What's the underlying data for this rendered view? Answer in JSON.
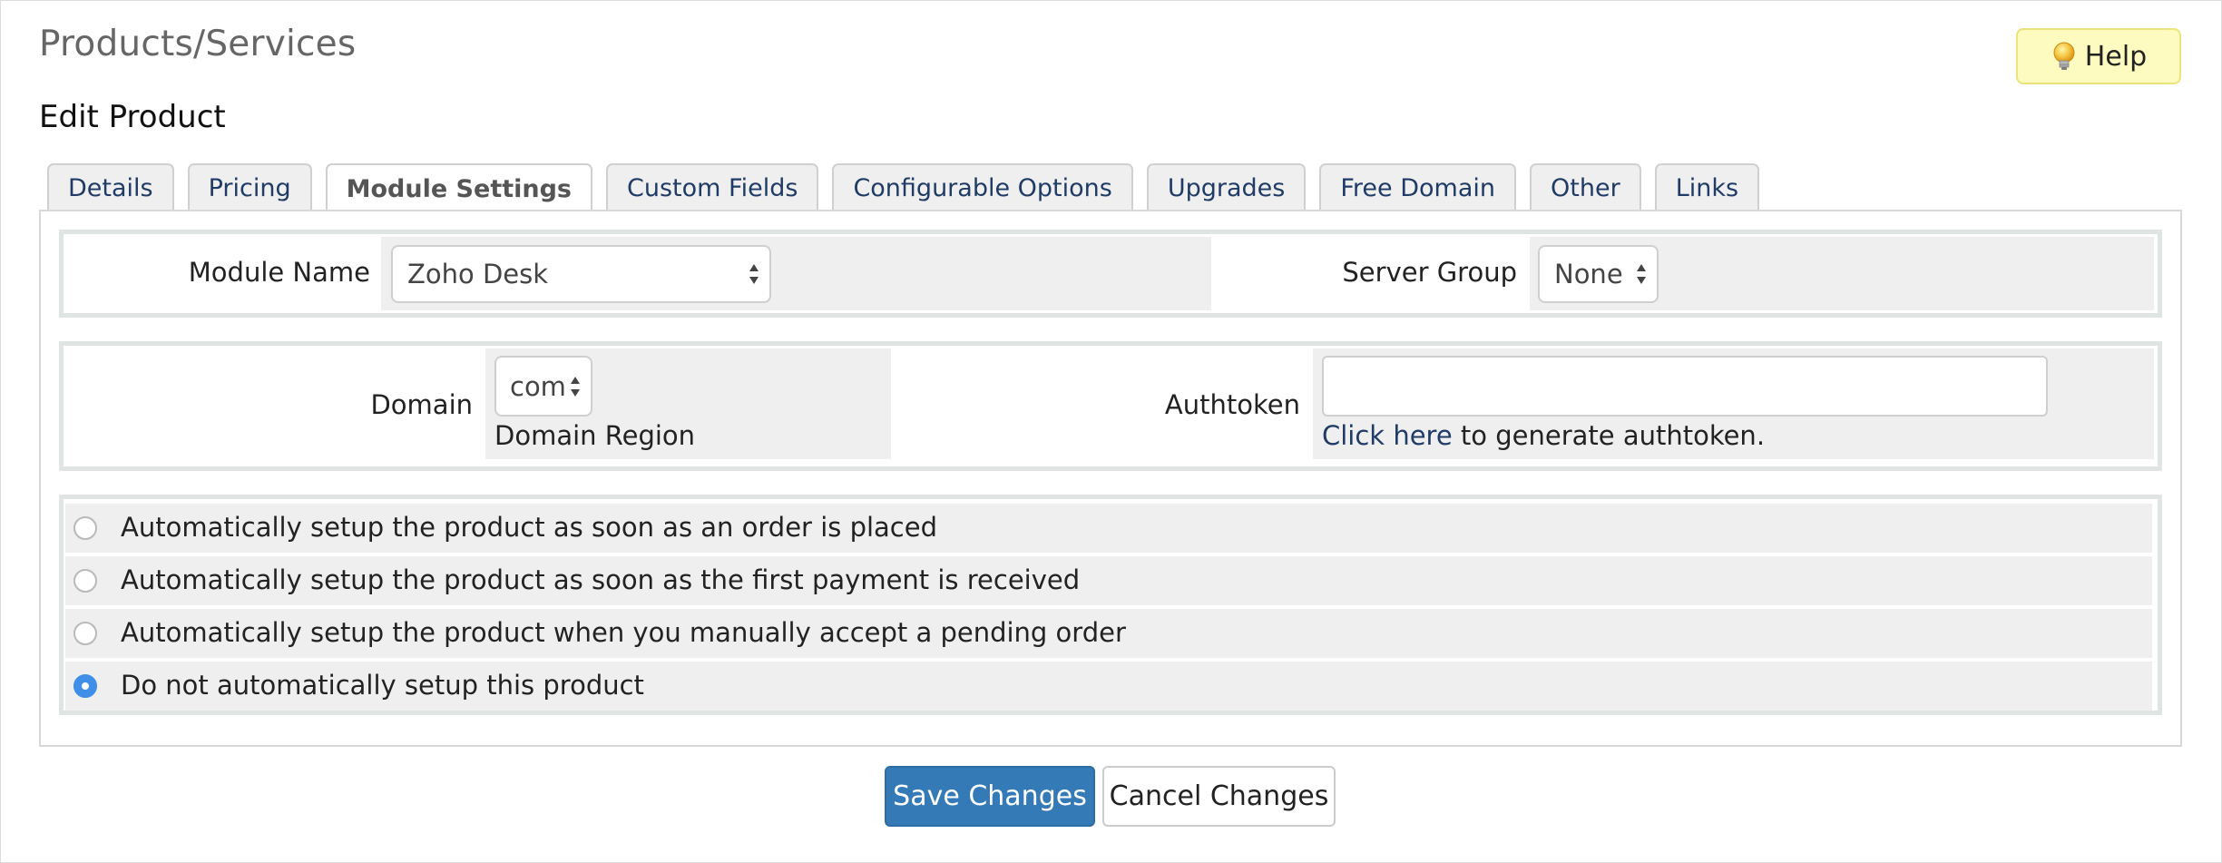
{
  "header": {
    "page_title": "Products/Services",
    "help_label": "Help",
    "sub_title": "Edit Product"
  },
  "tabs": [
    {
      "label": "Details"
    },
    {
      "label": "Pricing"
    },
    {
      "label": "Module Settings",
      "active": true
    },
    {
      "label": "Custom Fields"
    },
    {
      "label": "Configurable Options"
    },
    {
      "label": "Upgrades"
    },
    {
      "label": "Free Domain"
    },
    {
      "label": "Other"
    },
    {
      "label": "Links"
    }
  ],
  "module": {
    "module_name_label": "Module Name",
    "module_name_value": "Zoho Desk",
    "server_group_label": "Server Group",
    "server_group_value": "None"
  },
  "config": {
    "domain_label": "Domain",
    "domain_value": "com",
    "domain_hint": "Domain Region",
    "authtoken_label": "Authtoken",
    "authtoken_value": "",
    "authtoken_link": "Click here",
    "authtoken_hint": " to generate authtoken."
  },
  "setup_options": [
    {
      "label": "Automatically setup the product as soon as an order is placed",
      "checked": false
    },
    {
      "label": "Automatically setup the product as soon as the first payment is received",
      "checked": false
    },
    {
      "label": "Automatically setup the product when you manually accept a pending order",
      "checked": false
    },
    {
      "label": "Do not automatically setup this product",
      "checked": true
    }
  ],
  "actions": {
    "save_label": "Save Changes",
    "cancel_label": "Cancel Changes"
  },
  "colors": {
    "primary": "#337ab7",
    "link": "#1f3b66",
    "help_bg": "#fdfbc0",
    "radio_checked": "#3f8ee8"
  }
}
